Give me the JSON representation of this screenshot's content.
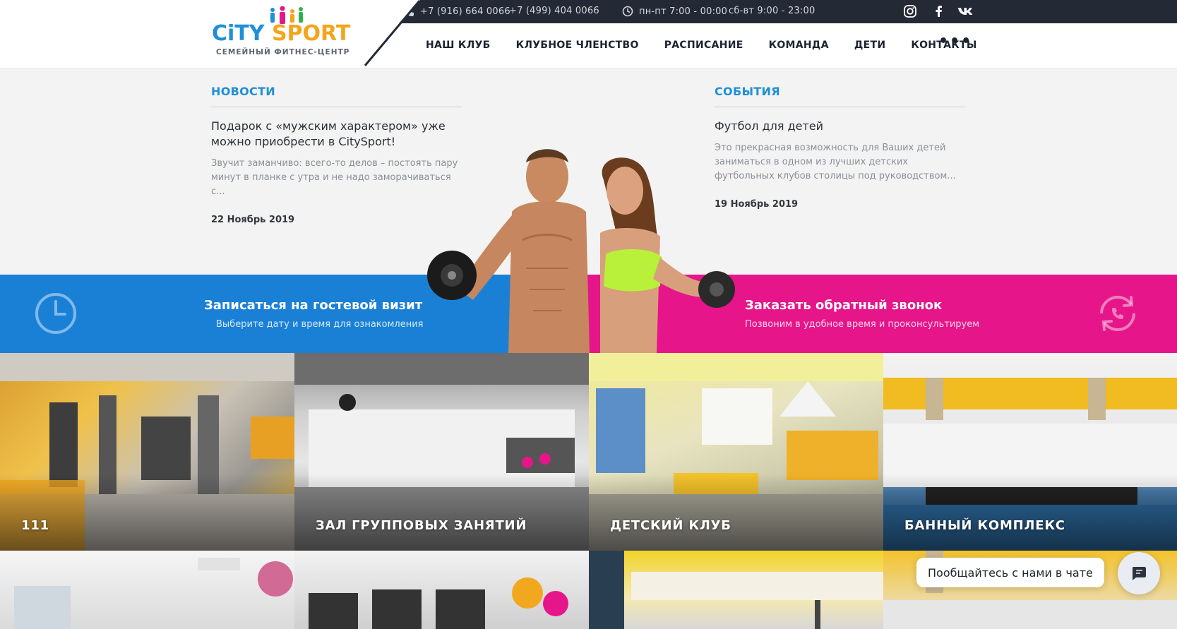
{
  "header": {
    "logo": {
      "word1": "CiTY",
      "word2": "SPORT",
      "subtitle": "СЕМЕЙНЫЙ ФИТНЕС-ЦЕНТР"
    },
    "phones": [
      "+7 (916) 664 0066",
      "+7 (499) 404 0066"
    ],
    "hours": {
      "weekdays": "пн-пт 7:00 - 00:00",
      "weekend": "сб-вт 9:00 - 23:00"
    },
    "socials": [
      "instagram-icon",
      "facebook-icon",
      "vk-icon"
    ],
    "nav": [
      "НАШ КЛУБ",
      "КЛУБНОЕ ЧЛЕНСТВО",
      "РАСПИСАНИЕ",
      "КОМАНДА",
      "ДЕТИ",
      "КОНТАКТЫ"
    ],
    "more": "•••"
  },
  "news": {
    "heading": "НОВОСТИ",
    "title": "Подарок с «мужским характером» уже можно приобрести в CitySport!",
    "text": "Звучит заманчиво: всего-то делов – постоять пару минут в планке с утра и не надо заморачиваться с...",
    "date": "22 Ноябрь 2019"
  },
  "events": {
    "heading": "СОБЫТИЯ",
    "title": "Футбол для детей",
    "text": "Это прекрасная возможность для Ваших детей заниматься в одном из лучших детских футбольных клубов столицы под руководством...",
    "date": "19 Ноябрь 2019"
  },
  "cta": {
    "guest": {
      "title": "Записаться на гостевой визит",
      "subtitle": "Выберите дату и время для ознакомления"
    },
    "callback": {
      "title": "Заказать обратный звонок",
      "subtitle": "Позвоним в удобное время и проконсультируем"
    }
  },
  "gallery": [
    {
      "label": "111"
    },
    {
      "label": "ЗАЛ ГРУППОВЫХ ЗАНЯТИЙ"
    },
    {
      "label": "ДЕТСКИЙ КЛУБ"
    },
    {
      "label": "БАННЫЙ КОМПЛЕКС"
    }
  ],
  "chat": {
    "text": "Пообщайтесь с нами в чате"
  },
  "colors": {
    "blue": "#1a80d6",
    "pink": "#e6158a",
    "dark": "#232a36",
    "orange": "#f4a51c"
  }
}
